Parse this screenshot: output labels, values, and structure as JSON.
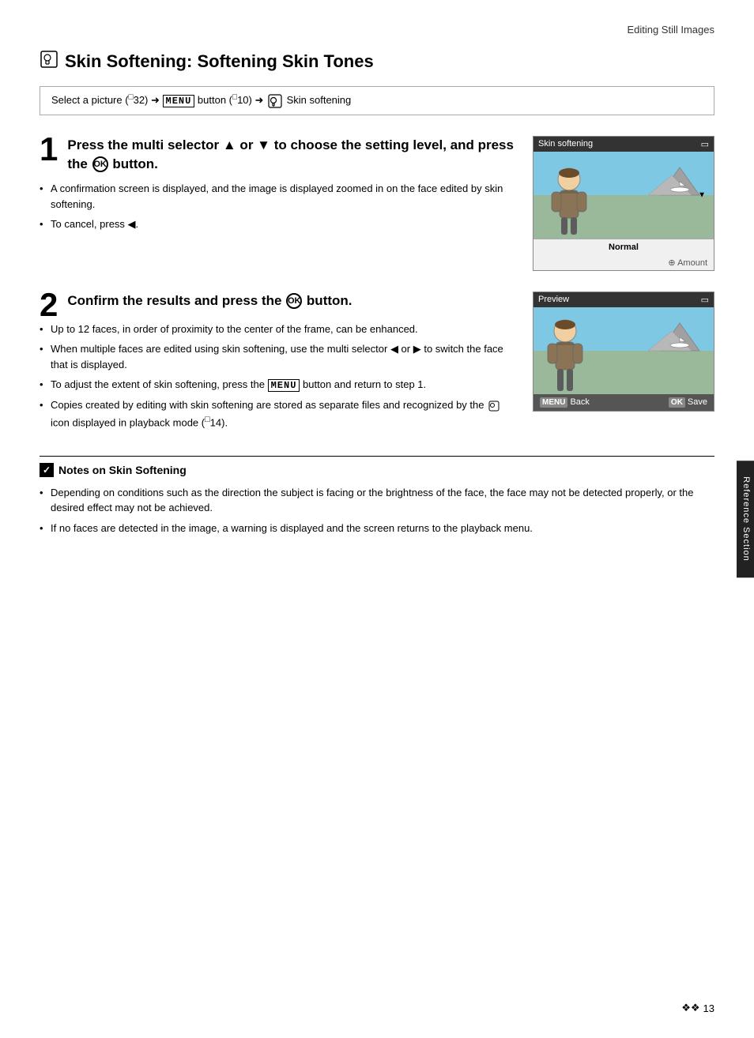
{
  "header": {
    "title": "Editing Still Images"
  },
  "page_title": {
    "icon_label": "☻",
    "text": "Skin Softening: Softening Skin Tones"
  },
  "breadcrumb": {
    "text": "Select a picture (",
    "ref1": "□32",
    "arrow1": "➜",
    "menu_label": "MENU",
    "text2": " button (",
    "ref2": "□10",
    "arrow2": "➜",
    "skin_icon": "☻",
    "end": " Skin softening"
  },
  "step1": {
    "number": "1",
    "title_part1": "Press the multi selector ",
    "up_arrow": "▲",
    "title_or": " or ",
    "down_arrow": "▼",
    "title_part2": " to choose the setting level, and press the ",
    "ok_text": "OK",
    "title_part3": " button.",
    "bullets": [
      "A confirmation screen is displayed, and the image is displayed zoomed in on the face edited by skin softening.",
      "To cancel, press ◀."
    ],
    "screen": {
      "title": "Skin softening",
      "battery_icon": "🔋",
      "level_label": "Normal",
      "amount_label": "⊕ Amount"
    }
  },
  "step2": {
    "number": "2",
    "title_part1": "Confirm the results and press the ",
    "ok_text": "OK",
    "title_part2": " button.",
    "bullets": [
      "Up to 12 faces, in order of proximity to the center of the frame, can be enhanced.",
      "When multiple faces are edited using skin softening, use the multi selector ◀ or ▶ to switch the face that is displayed.",
      "To adjust the extent of skin softening, press the MENU button and return to step 1.",
      "Copies created by editing with skin softening are stored as separate files and recognized by the ☻ icon displayed in playback mode (□14)."
    ],
    "screen": {
      "title": "Preview",
      "battery_icon": "🔋",
      "back_label": "MENU",
      "back_text": "Back",
      "save_label": "OK",
      "save_text": "Save"
    }
  },
  "notes": {
    "header": "Notes on Skin Softening",
    "bullets": [
      "Depending on conditions such as the direction the subject is facing or the brightness of the face, the face may not be detected properly, or the desired effect may not be achieved.",
      "If no faces are detected in the image, a warning is displayed and the screen returns to the playback menu."
    ]
  },
  "sidebar": {
    "label": "Reference Section"
  },
  "footer": {
    "page": "13",
    "dots": "❖❖"
  }
}
